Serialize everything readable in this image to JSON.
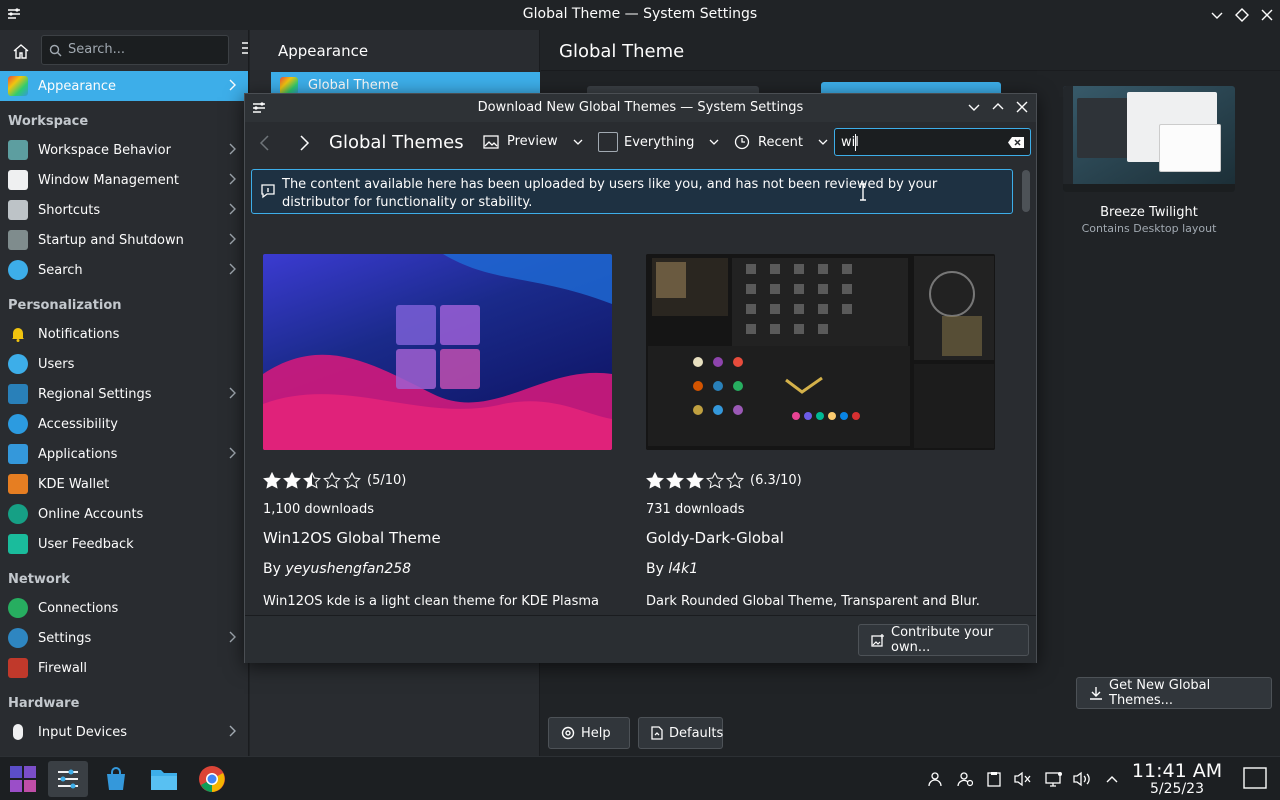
{
  "window": {
    "title": "Global Theme — System Settings"
  },
  "sidebar": {
    "search_placeholder": "Search...",
    "selected": "Appearance",
    "sections": {
      "workspace": "Workspace",
      "personalization": "Personalization",
      "network": "Network",
      "hardware": "Hardware"
    },
    "items": [
      {
        "label": "Appearance"
      },
      {
        "label": "Workspace Behavior"
      },
      {
        "label": "Window Management"
      },
      {
        "label": "Shortcuts"
      },
      {
        "label": "Startup and Shutdown"
      },
      {
        "label": "Search"
      },
      {
        "label": "Notifications"
      },
      {
        "label": "Users"
      },
      {
        "label": "Regional Settings"
      },
      {
        "label": "Accessibility"
      },
      {
        "label": "Applications"
      },
      {
        "label": "KDE Wallet"
      },
      {
        "label": "Online Accounts"
      },
      {
        "label": "User Feedback"
      },
      {
        "label": "Connections"
      },
      {
        "label": "Settings"
      },
      {
        "label": "Firewall"
      },
      {
        "label": "Input Devices"
      }
    ]
  },
  "midcol": {
    "header": "Appearance",
    "selected_item": "Global Theme"
  },
  "content": {
    "header": "Global Theme",
    "theme": {
      "name": "Breeze Twilight",
      "subtitle": "Contains Desktop layout"
    },
    "get_new_button": "Get New Global Themes...",
    "help_button": "Help",
    "defaults_button": "Defaults"
  },
  "dialog": {
    "title": "Download New Global Themes — System Settings",
    "crumb": "Global Themes",
    "view_mode": "Preview",
    "filter": "Everything",
    "sort": "Recent",
    "search_value": "wil",
    "notice": "The content available here has been uploaded by users like you, and has not been reviewed by your distributor for functionality or stability.",
    "contribute_button": "Contribute your own...",
    "items": [
      {
        "rating_text": "(5/10)",
        "rating": 2.5,
        "downloads": "1,100 downloads",
        "name": "Win12OS Global Theme",
        "by_prefix": "By",
        "author": "yeyushengfan258",
        "description": "Win12OS kde is a light clean theme for KDE Plasma"
      },
      {
        "rating_text": "(6.3/10)",
        "rating": 3,
        "downloads": "731 downloads",
        "name": "Goldy-Dark-Global",
        "by_prefix": "By",
        "author": "l4k1",
        "description": "Dark Rounded Global Theme, Transparent and Blur."
      }
    ]
  },
  "taskbar": {
    "time": "11:41 AM",
    "date": "5/25/23"
  },
  "colors": {
    "accent": "#3daee9",
    "bg": "#202326",
    "panel": "#292c30"
  }
}
